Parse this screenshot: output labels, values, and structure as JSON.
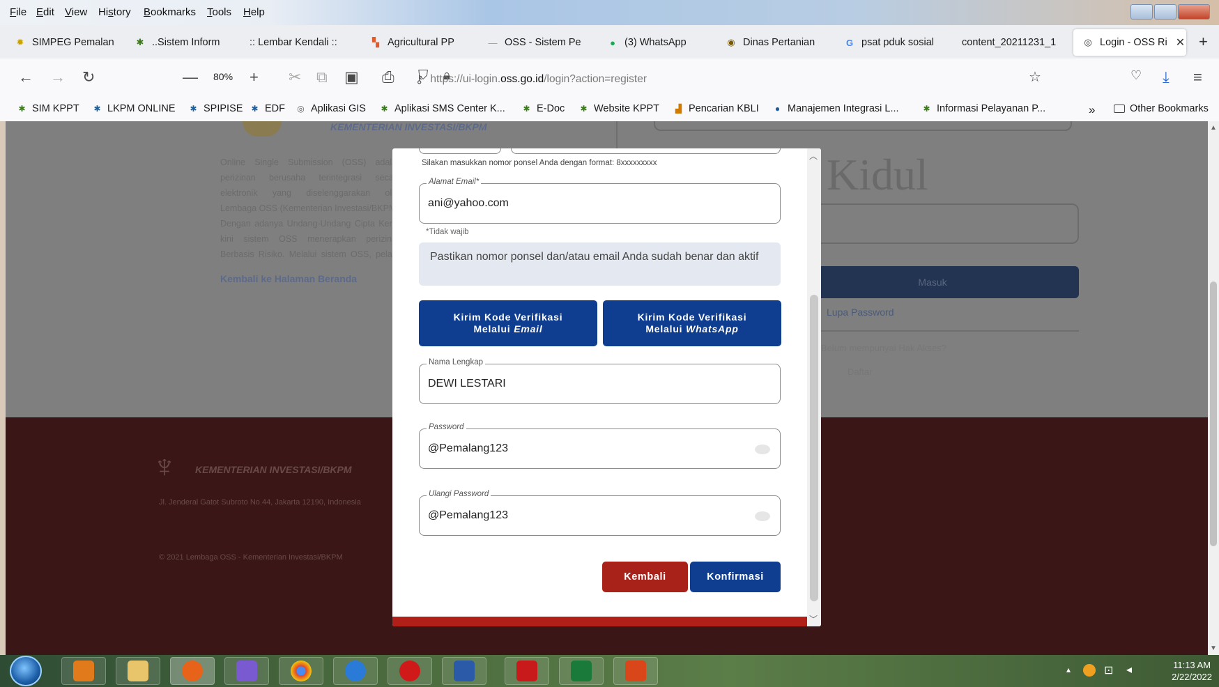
{
  "menu": {
    "items": [
      {
        "pre": "",
        "u": "F",
        "post": "ile"
      },
      {
        "pre": "",
        "u": "E",
        "post": "dit"
      },
      {
        "pre": "",
        "u": "V",
        "post": "iew"
      },
      {
        "pre": "Hi",
        "u": "s",
        "post": "tory"
      },
      {
        "pre": "",
        "u": "B",
        "post": "ookmarks"
      },
      {
        "pre": "",
        "u": "T",
        "post": "ools"
      },
      {
        "pre": "",
        "u": "H",
        "post": "elp"
      }
    ]
  },
  "tabs": [
    {
      "label": "SIMPEG Pemalan",
      "icon": "gear-logo-icon",
      "color": "#c8a200"
    },
    {
      "label": "..Sistem Inform",
      "icon": "emblem-icon",
      "color": "#3a7a1a"
    },
    {
      "label": ":: Lembar Kendali ::",
      "icon": "",
      "color": ""
    },
    {
      "label": "Agricultural PP",
      "icon": "grid-logo-icon",
      "color": "#e25b2c"
    },
    {
      "label": "OSS - Sistem Pe",
      "icon": "dash-icon",
      "color": "#999999"
    },
    {
      "label": "(3) WhatsApp",
      "icon": "whatsapp-icon",
      "color": "#1ea952"
    },
    {
      "label": "Dinas Pertanian",
      "icon": "seal-icon",
      "color": "#7a5a00"
    },
    {
      "label": "psat pduk sosial",
      "icon": "google-icon",
      "color": "#4285f4"
    },
    {
      "label": "content_20211231_1",
      "icon": "",
      "color": ""
    },
    {
      "label": "Login - OSS Ri",
      "icon": "globe-icon",
      "color": "#333333",
      "active": true
    }
  ],
  "nav": {
    "zoom": "80%",
    "url_prefix": "https://ui-login.",
    "url_domain": "oss.go.id",
    "url_suffix": "/login?action=register"
  },
  "bookmarks": [
    {
      "label": "SIM KPPT",
      "color": "#3a7a1a"
    },
    {
      "label": "LKPM ONLINE",
      "color": "#1f5c9a"
    },
    {
      "label": "SPIPISE",
      "color": "#1f5c9a"
    },
    {
      "label": "EDF",
      "color": "#1f5c9a"
    },
    {
      "label": "Aplikasi GIS",
      "color": "#555555"
    },
    {
      "label": "Aplikasi SMS Center K...",
      "color": "#3a7a1a"
    },
    {
      "label": "E-Doc",
      "color": "#3a7a1a"
    },
    {
      "label": "Website KPPT",
      "color": "#3a7a1a"
    },
    {
      "label": "Pencarian KBLI",
      "color": "#d07a00"
    },
    {
      "label": "Manajemen Integrasi L...",
      "color": "#1f5c9a"
    },
    {
      "label": "Informasi Pelayanan P...",
      "color": "#3a7a1a"
    }
  ],
  "other_bookmarks": "Other Bookmarks",
  "page": {
    "header_brand": "KEMENTERIAN INVESTASI/BKPM",
    "left_paragraph": "Online Single Submission (OSS) adalah perizinan berusaha terintegrasi secara elektronik yang diselenggarakan oleh Lembaga OSS (Kementerian Investasi/BKPM). Dengan adanya Undang-Undang Cipta Kerja, kini sistem OSS menerapkan perizinan Berbasis Risiko. Melalui sistem OSS, pelaku usaha menjadi lebih mudah, efektif dan efisien.",
    "back_link": "Kembali ke Halaman Beranda",
    "kidul": "Kidul",
    "masuk": "Masuk",
    "lupa_password": "Lupa Password",
    "belum_punya": "Belum mempunyai Hak Akses?",
    "daftar": "Daftar",
    "footer_brand": "KEMENTERIAN INVESTASI/BKPM",
    "footer_address": "Jl. Jenderal Gatot Subroto No.44, Jakarta 12190, Indonesia",
    "footer_copy": "© 2021 Lembaga OSS - Kementerian Investasi/BKPM"
  },
  "modal": {
    "phone_hint": "Silakan masukkan nomor ponsel Anda dengan format: 8xxxxxxxxx",
    "email_label": "Alamat Email*",
    "email_value": "ani@yahoo.com",
    "optional_note": "*Tidak wajib",
    "notice": "Pastikan nomor ponsel dan/atau email Anda sudah benar dan aktif",
    "btn_email_line1": "Kirim Kode Verifikasi",
    "btn_email_line2a": "Melalui ",
    "btn_email_line2b": "Email",
    "btn_wa_line1": "Kirim Kode Verifikasi",
    "btn_wa_line2a": "Melalui ",
    "btn_wa_line2b": "WhatsApp",
    "name_label": "Nama Lengkap",
    "name_value": "DEWI LESTARI",
    "password_label": "Password",
    "password_value": "@Pemalang123",
    "repeat_label": "Ulangi Password",
    "repeat_value": "@Pemalang123",
    "back_button": "Kembali",
    "confirm_button": "Konfirmasi"
  },
  "taskbar": {
    "time": "11:13 AM",
    "date": "2/22/2022"
  },
  "colors": {
    "primary_blue": "#0f3d8f",
    "danger_red": "#a8221a",
    "footer_maroon": "#3a1716"
  }
}
